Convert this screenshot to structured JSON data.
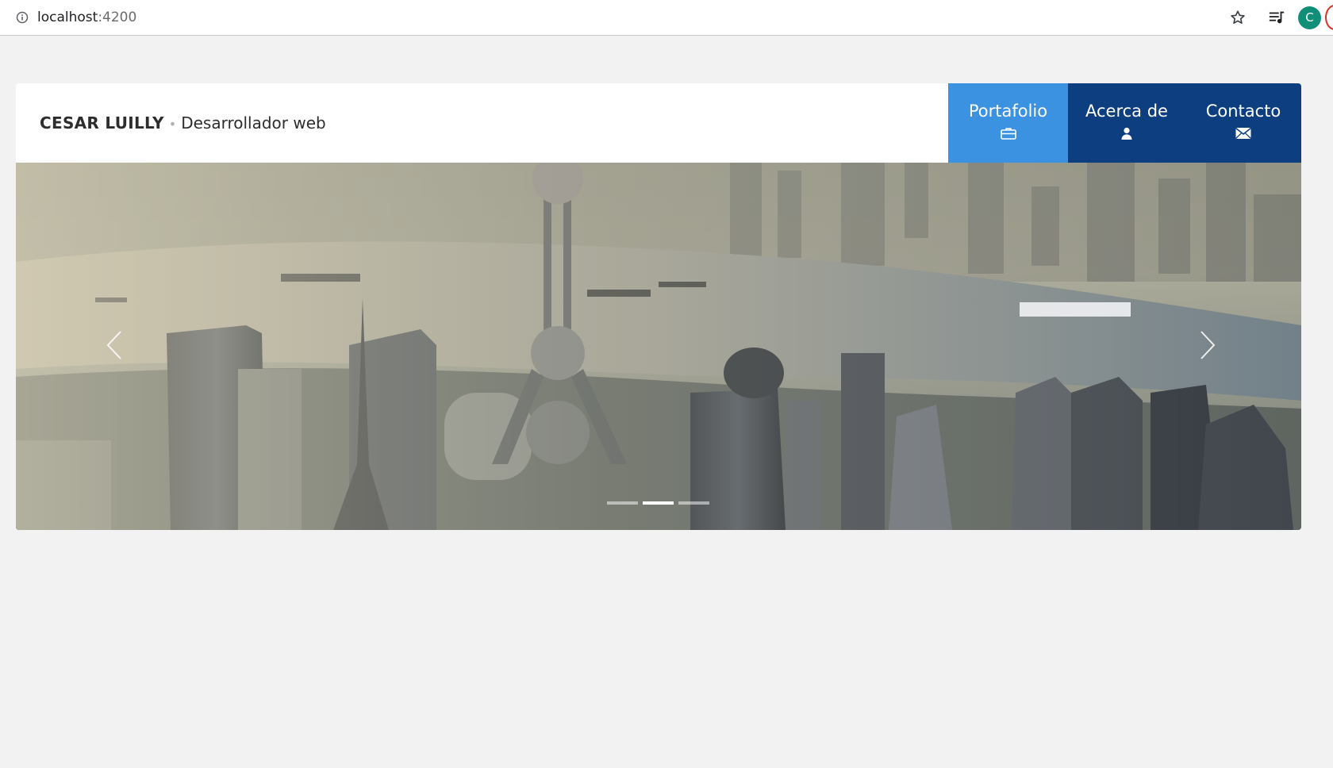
{
  "browser": {
    "url_host": "localhost",
    "url_port": ":4200",
    "avatar_letter": "C",
    "icons": [
      "info-icon",
      "star-icon",
      "media-queue-icon"
    ]
  },
  "header": {
    "brand_name": "CESAR LUILLY",
    "separator": "•",
    "subtitle": "Desarrollador web"
  },
  "nav": {
    "items": [
      {
        "label": "Portafolio",
        "icon": "briefcase-icon",
        "active": true
      },
      {
        "label": "Acerca de",
        "icon": "user-icon",
        "active": false
      },
      {
        "label": "Contacto",
        "icon": "envelope-icon",
        "active": false
      }
    ]
  },
  "carousel": {
    "slide_count": 3,
    "active_index": 1,
    "image": "aerial-city-skyline-with-river"
  },
  "colors": {
    "page_bg": "#f2f2f2",
    "nav_active": "#3b92e0",
    "nav_default": "#0d3f80",
    "avatar": "#0f8f78"
  }
}
